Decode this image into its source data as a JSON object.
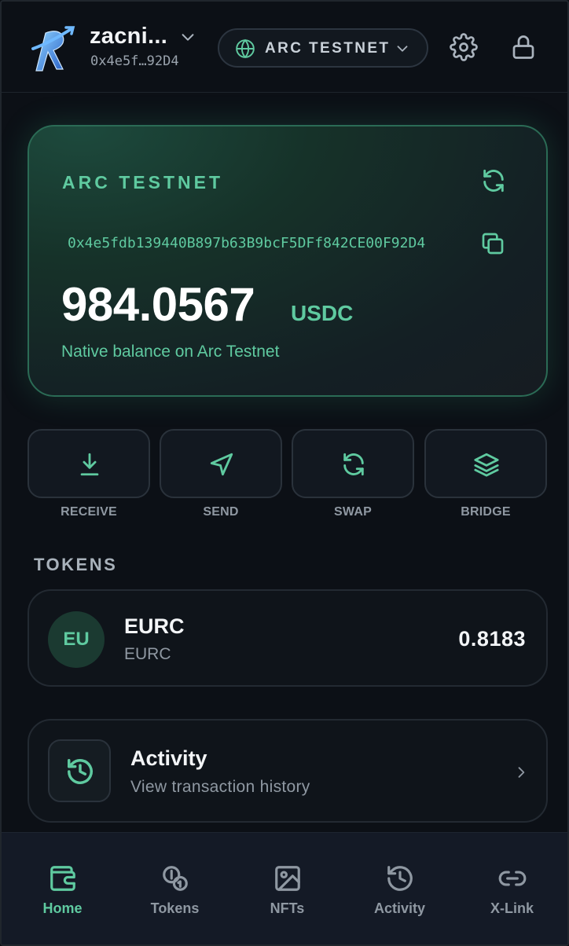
{
  "header": {
    "account_name": "zacni...",
    "account_address": "0x4e5f…92D4",
    "network_label": "ARC TESTNET",
    "icons": [
      "logo",
      "chevron-down-icon",
      "globe-icon",
      "gear-icon",
      "lock-icon"
    ]
  },
  "balance_card": {
    "network": "ARC TESTNET",
    "address": "0x4e5fdb139440B897b63B9bcF5DFf842CE00F92D4",
    "balance": "984.0567",
    "unit": "USDC",
    "subtitle": "Native balance on Arc Testnet"
  },
  "actions": [
    {
      "label": "RECEIVE",
      "icon": "download-icon"
    },
    {
      "label": "SEND",
      "icon": "send-icon"
    },
    {
      "label": "SWAP",
      "icon": "swap-icon"
    },
    {
      "label": "BRIDGE",
      "icon": "layers-icon"
    }
  ],
  "tokens": {
    "title": "TOKENS",
    "items": [
      {
        "avatar": "EU",
        "symbol": "EURC",
        "name": "EURC",
        "amount": "0.8183"
      }
    ]
  },
  "activity": {
    "title": "Activity",
    "subtitle": "View transaction history"
  },
  "bottom_nav": {
    "active": "Home",
    "items": [
      {
        "label": "Home",
        "icon": "wallet-icon"
      },
      {
        "label": "Tokens",
        "icon": "coins-icon"
      },
      {
        "label": "NFTs",
        "icon": "image-icon"
      },
      {
        "label": "Activity",
        "icon": "history-icon"
      },
      {
        "label": "X-Link",
        "icon": "link-icon"
      }
    ]
  },
  "colors": {
    "accent": "#5fcaa0",
    "background": "#0c1016",
    "card_border": "#2b6b55"
  }
}
